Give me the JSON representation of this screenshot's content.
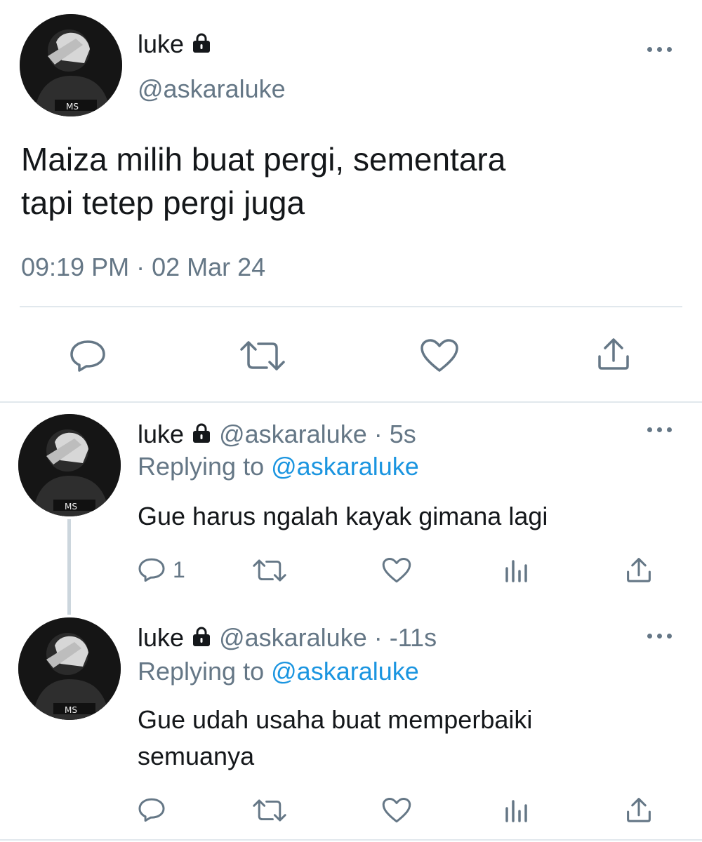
{
  "main_tweet": {
    "display_name": "luke",
    "handle": "@askaraluke",
    "text_line1": "Maiza milih buat pergi, sementara",
    "text_line2": "tapi tetep pergi juga",
    "timestamp": "09:19 PM · 02 Mar 24",
    "actions": [
      "reply-icon",
      "retweet-icon",
      "like-icon",
      "share-icon"
    ]
  },
  "replies": [
    {
      "display_name": "luke",
      "handle": "@askaraluke",
      "time": "5s",
      "replying_prefix": "Replying to",
      "replying_to": "@askaraluke",
      "text_line1": "Gue harus ngalah kayak gimana lagi",
      "text_line2": "",
      "reply_count": "1",
      "actions": [
        "reply-icon",
        "retweet-icon",
        "like-icon",
        "analytics-icon",
        "share-icon"
      ]
    },
    {
      "display_name": "luke",
      "handle": "@askaraluke",
      "time": "-11s",
      "replying_prefix": "Replying to",
      "replying_to": "@askaraluke",
      "text_line1": "Gue udah usaha buat memperbaiki",
      "text_line2": "semuanya",
      "reply_count": "",
      "actions": [
        "reply-icon",
        "retweet-icon",
        "like-icon",
        "analytics-icon",
        "share-icon"
      ]
    }
  ],
  "separator": " · ",
  "colors": {
    "text": "#14171a",
    "secondary": "#657786",
    "link": "#1b95e0",
    "divider": "#e1e8ed"
  }
}
